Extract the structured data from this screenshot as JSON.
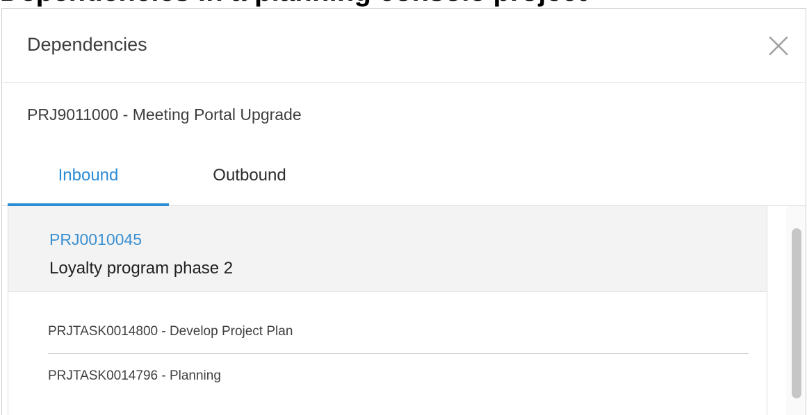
{
  "page_heading": "Dependencies in a planning console project",
  "dialog": {
    "title": "Dependencies",
    "close_icon": "close-icon"
  },
  "record": {
    "title": "PRJ9011000 - Meeting Portal Upgrade"
  },
  "tabs": [
    {
      "label": "Inbound",
      "active": true
    },
    {
      "label": "Outbound",
      "active": false
    }
  ],
  "dependency": {
    "number": "PRJ0010045",
    "name": "Loyalty program phase 2",
    "tasks": [
      {
        "label": "PRJTASK0014800 - Develop Project Plan"
      },
      {
        "label": "PRJTASK0014796 - Planning"
      }
    ]
  },
  "colors": {
    "accent": "#2b8cd6",
    "link": "#3a8fd0",
    "card_header_bg": "#f3f3f3",
    "scroll_thumb": "#c6c6c6"
  }
}
